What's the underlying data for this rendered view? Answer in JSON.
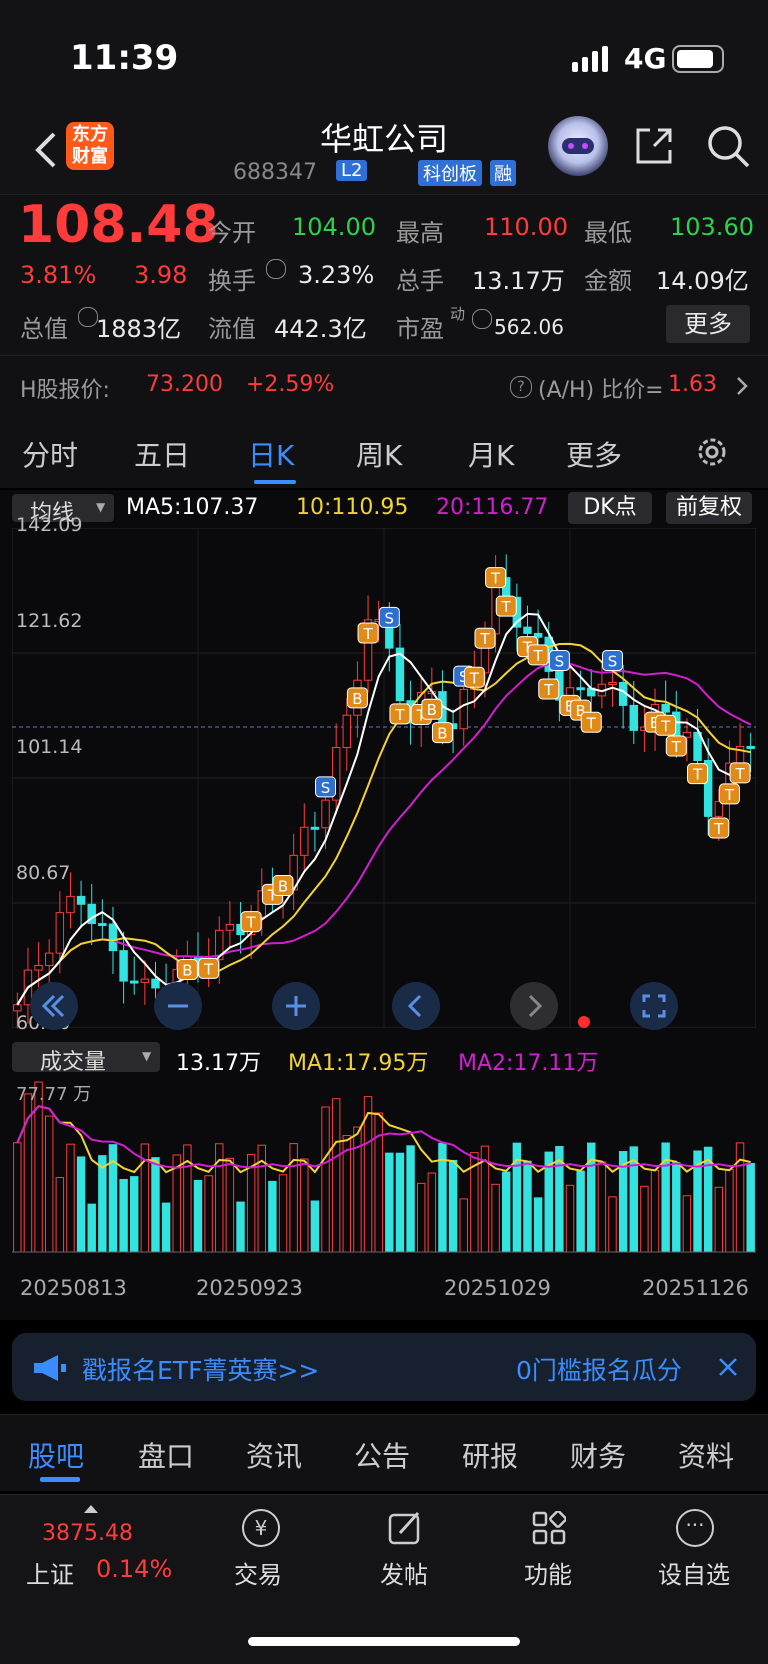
{
  "status": {
    "time": "11:39",
    "network": "4G"
  },
  "header": {
    "logo_line1": "东方",
    "logo_line2": "财富",
    "title": "华虹公司",
    "code": "688347",
    "badge_l2": "L2",
    "badge_board": "科创板",
    "badge_margin": "融"
  },
  "quote": {
    "price": "108.48",
    "change_pct": "3.81%",
    "change": "3.98",
    "open_label": "今开",
    "open": "104.00",
    "high_label": "最高",
    "high": "110.00",
    "low_label": "最低",
    "low": "103.60",
    "turnover_label": "换手",
    "turnover": "3.23%",
    "volume_label": "总手",
    "volume": "13.17万",
    "amount_label": "金额",
    "amount": "14.09亿",
    "mktcap_label": "总值",
    "mktcap": "1883亿",
    "float_label": "流值",
    "float_cap": "442.3亿",
    "pe_label": "市盈",
    "pe_sup": "动",
    "pe": "562.06",
    "more_button": "更多"
  },
  "hshare": {
    "label": "H股报价:",
    "price": "73.200",
    "pct": "+2.59%",
    "ratio_label": "(A/H) 比价=",
    "ratio": "1.63"
  },
  "period_tabs": [
    "分时",
    "五日",
    "日K",
    "周K",
    "月K",
    "更多"
  ],
  "active_tab": "日K",
  "ma_bar": {
    "selector": "均线",
    "ma5": "MA5:107.37",
    "ma10": "10:110.95",
    "ma20": "20:116.77",
    "dk_button": "DK点",
    "fq_button": "前复权"
  },
  "price_axis": [
    "142.09",
    "121.62",
    "101.14",
    "80.67",
    "60.20"
  ],
  "volume_bar": {
    "selector": "成交量",
    "vol": "13.17万",
    "ma1": "MA1:17.95万",
    "ma2": "MA2:17.11万",
    "axis_max": "77.77 万"
  },
  "dates": [
    "20250813",
    "20250923",
    "20251029",
    "20251126"
  ],
  "banner": {
    "left_text": "戳报名ETF菁英赛>>",
    "right_text": "0门槛报名瓜分"
  },
  "sub_tabs": [
    "股吧",
    "盘口",
    "资讯",
    "公告",
    "研报",
    "财务",
    "资料"
  ],
  "active_sub_tab": "股吧",
  "bottom": {
    "index_value": "3875.48",
    "index_name": "上证",
    "index_pct": "0.14%",
    "trade": "交易",
    "post": "发帖",
    "function": "功能",
    "watchlist": "设自选"
  },
  "colors": {
    "up": "#ff3b3b",
    "down": "#2bd24b",
    "cyan": "#32e3e0",
    "ma5": "#ffffff",
    "ma10": "#f2d335",
    "ma20": "#d21fd2",
    "accent": "#3b8cff"
  }
}
